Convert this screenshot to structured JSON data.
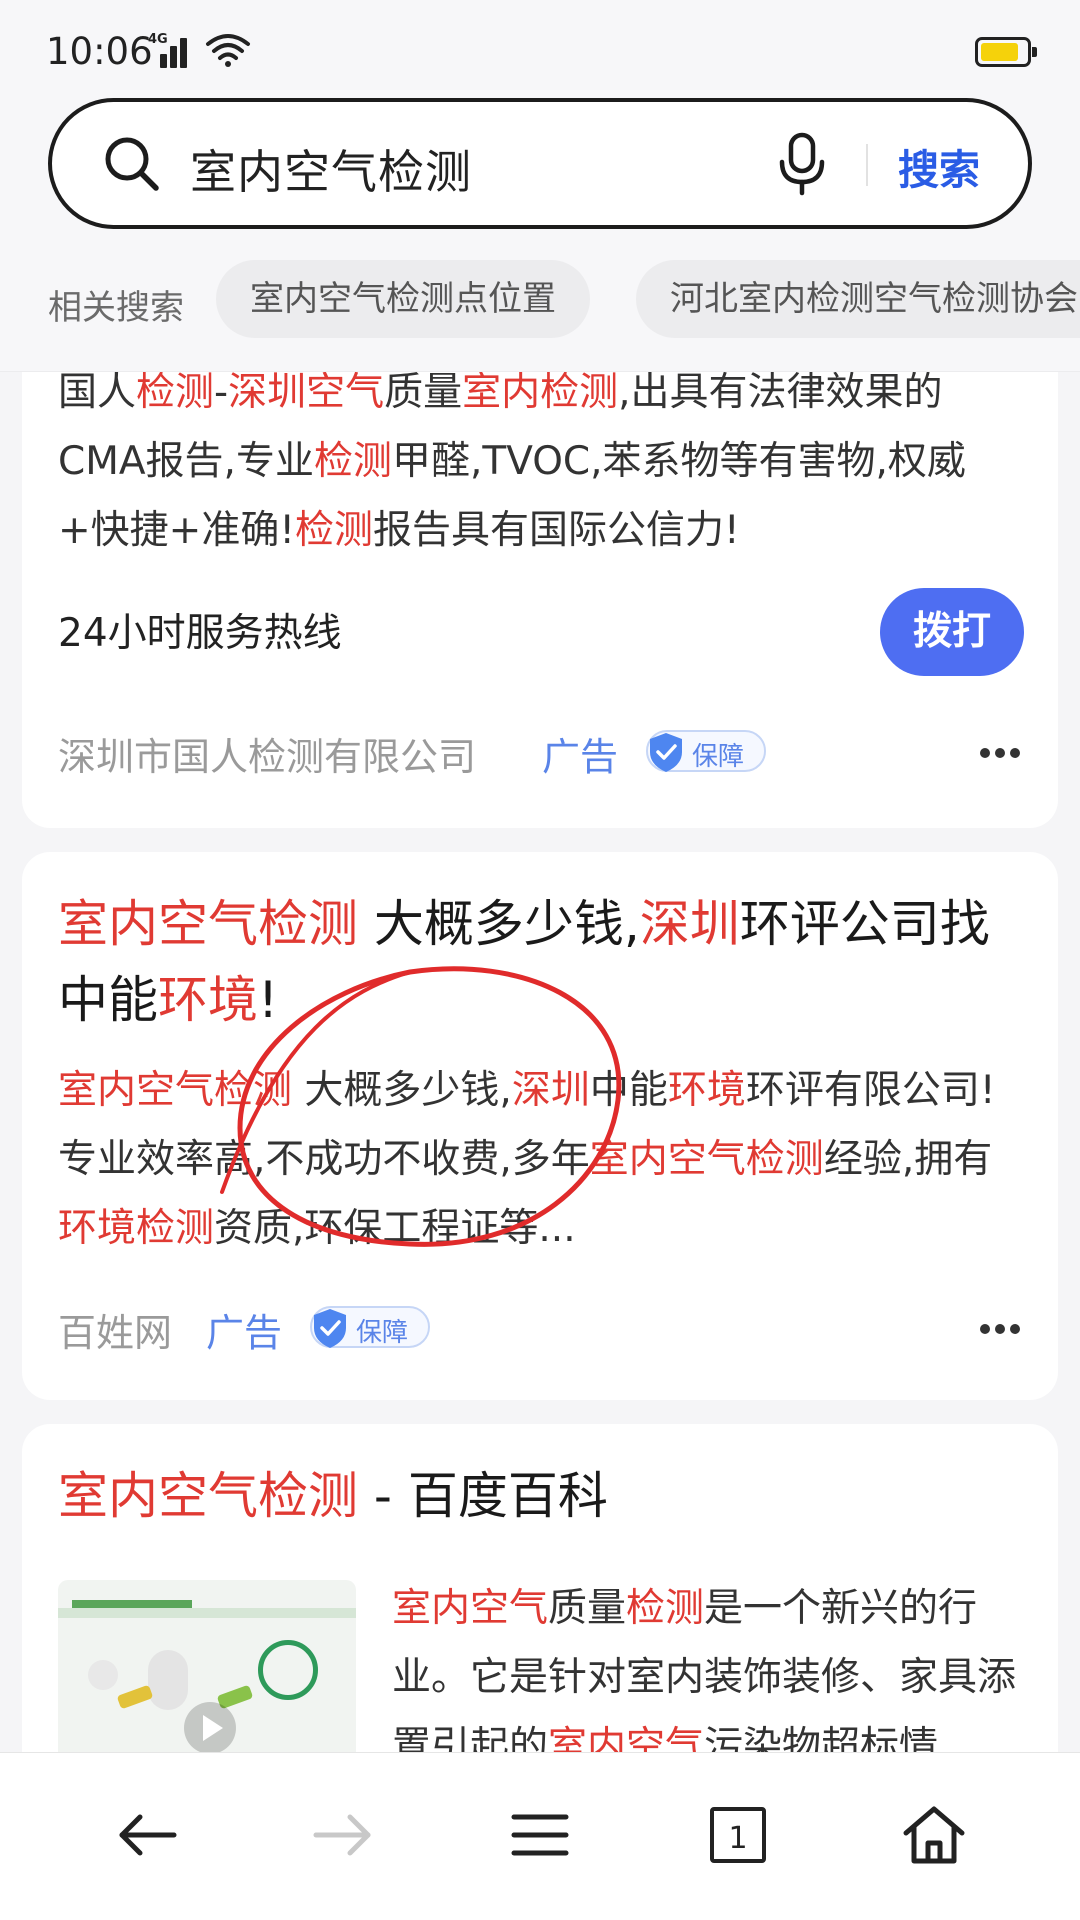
{
  "status_bar": {
    "time": "10:06",
    "network": "4G",
    "battery_level": 0.85,
    "battery_color": "#f5d20b"
  },
  "search": {
    "query": "室内空气检测",
    "button": "搜索"
  },
  "related": {
    "label": "相关搜索",
    "chips": [
      "室内空气检测点位置",
      "河北室内检测空气检测协会"
    ]
  },
  "results": [
    {
      "desc_segments": [
        {
          "t": "国人",
          "hl": false
        },
        {
          "t": "检测",
          "hl": true
        },
        {
          "t": "-",
          "hl": false
        },
        {
          "t": "深圳空气",
          "hl": true
        },
        {
          "t": "质量",
          "hl": false
        },
        {
          "t": "室内检测",
          "hl": true
        },
        {
          "t": ",出具有法律效果的CMA报告,专业",
          "hl": false
        },
        {
          "t": "检测",
          "hl": true
        },
        {
          "t": "甲醛,TVOC,苯系物等有害物,权威+快捷+准确!",
          "hl": false
        },
        {
          "t": "检测",
          "hl": true
        },
        {
          "t": "报告具有国际公信力!",
          "hl": false
        }
      ],
      "hotline": "24小时服务热线",
      "call_button": "拨打",
      "source": "深圳市国人检测有限公司",
      "ad_label": "广告",
      "badge": "保障"
    },
    {
      "title_segments": [
        {
          "t": "室内空气检测",
          "hl": true
        },
        {
          "t": " 大概多少钱,",
          "hl": false
        },
        {
          "t": "深圳",
          "hl": true
        },
        {
          "t": "环评公司找中能",
          "hl": false
        },
        {
          "t": "环境",
          "hl": true
        },
        {
          "t": "!",
          "hl": false
        }
      ],
      "desc_segments": [
        {
          "t": "室内空气检测",
          "hl": true
        },
        {
          "t": " 大概多少钱,",
          "hl": false
        },
        {
          "t": "深圳",
          "hl": true
        },
        {
          "t": "中能",
          "hl": false
        },
        {
          "t": "环境",
          "hl": true
        },
        {
          "t": "环评有限公司!专业效率高,不成功不收费,多年",
          "hl": false
        },
        {
          "t": "室内空气检测",
          "hl": true
        },
        {
          "t": "经验,拥有",
          "hl": false
        },
        {
          "t": "环境检测",
          "hl": true
        },
        {
          "t": "资质,环保工程证等...",
          "hl": false
        }
      ],
      "source": "百姓网",
      "ad_label": "广告",
      "badge": "保障"
    },
    {
      "title_segments": [
        {
          "t": "室内空气检测",
          "hl": true
        },
        {
          "t": " - 百度百科",
          "hl": false
        }
      ],
      "desc_segments": [
        {
          "t": "室内空气",
          "hl": true
        },
        {
          "t": "质量",
          "hl": false
        },
        {
          "t": "检测",
          "hl": true
        },
        {
          "t": "是一个新兴的行业。它是针对室内装饰装修、家具添置引起的",
          "hl": false
        },
        {
          "t": "室内空气",
          "hl": true
        },
        {
          "t": "污染物超标情",
          "hl": false
        }
      ]
    }
  ],
  "bottom_nav": {
    "tab_count": "1"
  },
  "colors": {
    "highlight": "#e03a33",
    "accent": "#4e6ef2",
    "link": "#2a5ce5",
    "annotation": "#e02b2b"
  }
}
